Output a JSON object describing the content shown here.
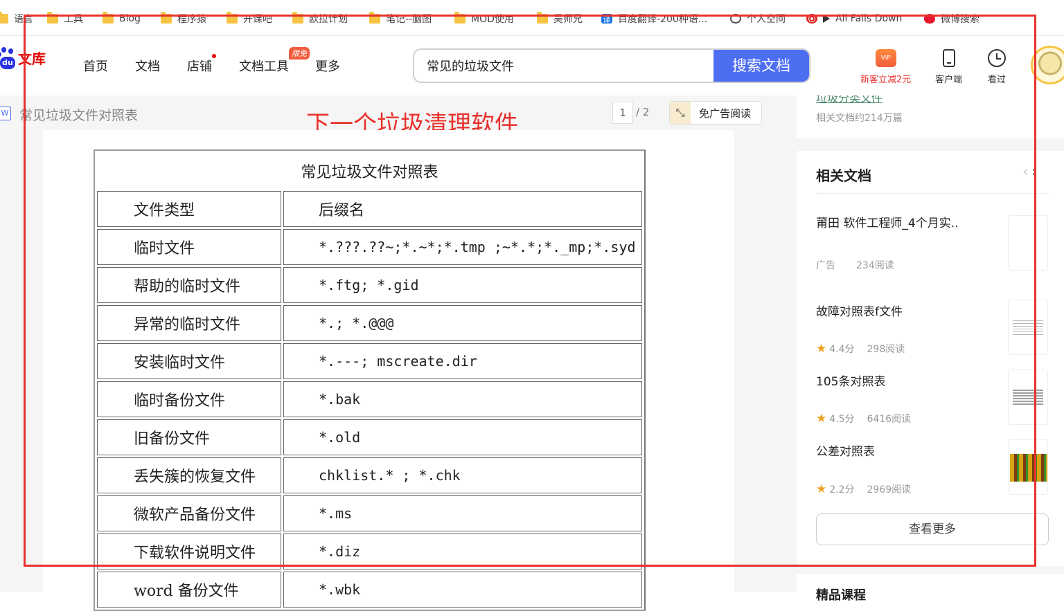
{
  "bookmarks": [
    {
      "label": "语言",
      "icon": "folder-icon"
    },
    {
      "label": "工具",
      "icon": "folder-icon"
    },
    {
      "label": "Blog",
      "icon": "folder-icon"
    },
    {
      "label": "程序猿",
      "icon": "folder-icon"
    },
    {
      "label": "开课吧",
      "icon": "folder-icon"
    },
    {
      "label": "欧拉计划",
      "icon": "folder-icon"
    },
    {
      "label": "笔记--脑图",
      "icon": "folder-icon"
    },
    {
      "label": "MOD使用",
      "icon": "folder-icon"
    },
    {
      "label": "吴师兄",
      "icon": "folder-icon"
    },
    {
      "label": "百度翻译-200种语...",
      "icon": "translate-icon"
    },
    {
      "label": "个人空间",
      "icon": "globe-icon"
    },
    {
      "label": "All Falls Down",
      "icon": "music-icon"
    },
    {
      "label": "微博搜索",
      "icon": "weibo-icon"
    }
  ],
  "header": {
    "logo_text": "文库",
    "logo_du": "du",
    "nav": [
      "首页",
      "文档",
      "店铺",
      "文档工具",
      "更多"
    ],
    "limit_badge": "限免",
    "search_value": "常见的垃圾文件",
    "search_button": "搜索文档",
    "vip_label": "新客立减2元",
    "vip_icon_text": "VIP",
    "client_label": "客户端",
    "history_label": "看过"
  },
  "doc": {
    "title": "常见垃圾文件对照表",
    "annotation": "下一个垃圾清理软件",
    "page_current": "1",
    "page_total": "/ 2",
    "noad_label": "免广告阅读",
    "table_caption": "常见垃圾文件对照表",
    "header_row": [
      "文件类型",
      "后缀名"
    ],
    "rows": [
      [
        "临时文件",
        "*.???.??~;*.~*;*.tmp ;~*.*;*._mp;*.syd"
      ],
      [
        "帮助的临时文件",
        "*.ftg; *.gid"
      ],
      [
        "异常的临时文件",
        "*.; *.@@@"
      ],
      [
        "安装临时文件",
        "*.---; mscreate.dir"
      ],
      [
        "临时备份文件",
        "*.bak"
      ],
      [
        "旧备份文件",
        "*.old"
      ],
      [
        "丢失簇的恢复文件",
        "chklist.* ; *.chk"
      ],
      [
        "微软产品备份文件",
        "*.ms"
      ],
      [
        "下载软件说明文件",
        "*.diz"
      ],
      [
        "word 备份文件",
        "*.wbk"
      ]
    ]
  },
  "sidebar": {
    "top_link": "垃圾分类文件",
    "top_sub": "相关文档约214万篇",
    "related_heading": "相关文档",
    "related": [
      {
        "title": "莆田 软件工程师_4个月实..",
        "tag": "广告",
        "reads": "234阅读"
      },
      {
        "title": "故障对照表f文件",
        "rating": "4.4分",
        "reads": "298阅读"
      },
      {
        "title": "105条对照表",
        "rating": "4.5分",
        "reads": "6416阅读"
      },
      {
        "title": "公差对照表",
        "rating": "2.2分",
        "reads": "2969阅读"
      }
    ],
    "more_button": "查看更多",
    "bottom_heading": "精品课程"
  },
  "colors": {
    "brand_blue": "#4e6ef2",
    "brand_red": "#e10602",
    "annotation_red": "#e8312c"
  }
}
